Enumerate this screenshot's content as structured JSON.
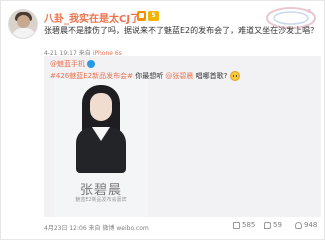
{
  "post": {
    "username": "八卦_我实在是太CJ了",
    "level_badge": "5",
    "text": "张碧晨不是膝伤了吗，据说来不了魅蓝E2的发布会了，难道又坐在沙发上唱？",
    "meta": {
      "time": "4-21 19:17",
      "from": "来自",
      "source": "iPhone 6s"
    }
  },
  "repost": {
    "user": "@魅蓝手机",
    "text_tag": "#426魅蓝E2新品发布会#",
    "text_middle": " 你最想听 ",
    "text_mention": "@张碧晨",
    "text_end": " 唱哪首歌?",
    "poster": {
      "name": "张碧晨",
      "caption": "魅蓝E2新品发布会嘉宾"
    },
    "footer": "4月23日 12:06 来自 微博 weibo.com"
  },
  "stats": {
    "shares": "585",
    "comments": "59",
    "likes": "948"
  },
  "colors": {
    "accent": "#eb7350",
    "repost_bg": "#f2f2f5",
    "verified_blue": "#2a9ae5"
  }
}
